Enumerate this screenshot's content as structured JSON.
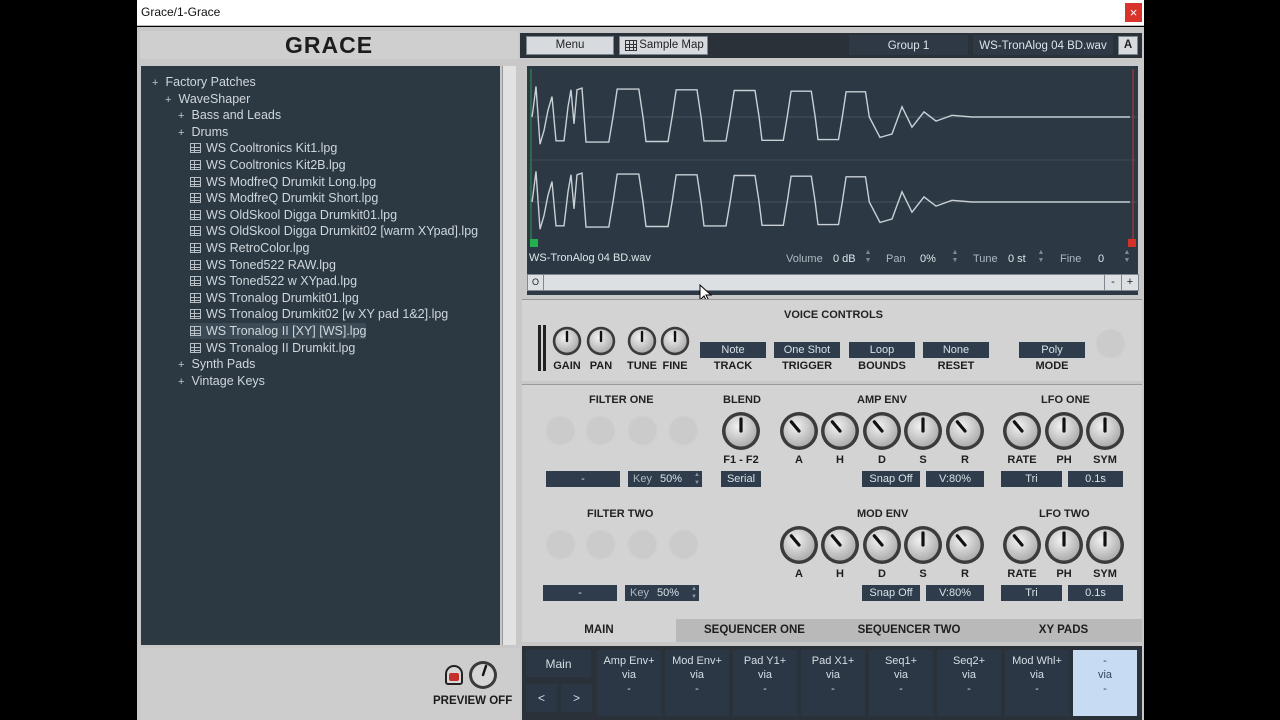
{
  "window": {
    "title": "Grace/1-Grace",
    "close": "×"
  },
  "app": {
    "logo": "GRACE"
  },
  "browser": {
    "items": [
      {
        "level": 0,
        "expander": "+",
        "label": "Factory Patches",
        "type": "folder"
      },
      {
        "level": 1,
        "expander": "+",
        "label": "WaveShaper",
        "type": "folder"
      },
      {
        "level": 2,
        "expander": "+",
        "label": "Bass and Leads",
        "type": "folder"
      },
      {
        "level": 2,
        "expander": "+",
        "label": "Drums",
        "type": "folder"
      },
      {
        "level": 3,
        "label": "WS Cooltronics Kit1.lpg",
        "type": "file"
      },
      {
        "level": 3,
        "label": "WS Cooltronics Kit2B.lpg",
        "type": "file"
      },
      {
        "level": 3,
        "label": "WS ModfreQ Drumkit Long.lpg",
        "type": "file"
      },
      {
        "level": 3,
        "label": "WS ModfreQ Drumkit Short.lpg",
        "type": "file"
      },
      {
        "level": 3,
        "label": "WS OldSkool Digga Drumkit01.lpg",
        "type": "file"
      },
      {
        "level": 3,
        "label": "WS OldSkool Digga Drumkit02 [warm XYpad].lpg",
        "type": "file"
      },
      {
        "level": 3,
        "label": "WS RetroColor.lpg",
        "type": "file"
      },
      {
        "level": 3,
        "label": "WS Toned522 RAW.lpg",
        "type": "file"
      },
      {
        "level": 3,
        "label": "WS Toned522 w XYpad.lpg",
        "type": "file"
      },
      {
        "level": 3,
        "label": "WS Tronalog Drumkit01.lpg",
        "type": "file"
      },
      {
        "level": 3,
        "label": "WS Tronalog Drumkit02 [w XY pad 1&2].lpg",
        "type": "file"
      },
      {
        "level": 3,
        "label": "WS Tronalog II  [XY] [WS].lpg",
        "type": "file",
        "selected": true
      },
      {
        "level": 3,
        "label": "WS Tronalog II Drumkit.lpg",
        "type": "file"
      },
      {
        "level": 2,
        "expander": "+",
        "label": "Synth Pads",
        "type": "folder"
      },
      {
        "level": 2,
        "expander": "+",
        "label": "Vintage Keys",
        "type": "folder"
      }
    ],
    "preview_label": "PREVIEW OFF"
  },
  "topbar": {
    "menu": "Menu",
    "sample_map": "Sample Map",
    "group": "Group 1",
    "sample": "WS-TronAlog 04 BD.wav",
    "a_button": "A"
  },
  "waveform": {
    "filename": "WS-TronAlog 04 BD.wav",
    "volume_label": "Volume",
    "volume_value": "0 dB",
    "pan_label": "Pan",
    "pan_value": "0%",
    "tune_label": "Tune",
    "tune_value": "0 st",
    "fine_label": "Fine",
    "fine_value": "0",
    "scroll_left": "O",
    "zoom_out": "-",
    "zoom_in": "+"
  },
  "voice": {
    "title": "VOICE CONTROLS",
    "knobs": [
      "GAIN",
      "PAN",
      "TUNE",
      "FINE"
    ],
    "track_value": "Note",
    "track_label": "TRACK",
    "trigger_value": "One Shot",
    "trigger_label": "TRIGGER",
    "bounds_value": "Loop",
    "bounds_label": "BOUNDS",
    "reset_value": "None",
    "reset_label": "RESET",
    "mode_value": "Poly",
    "mode_label": "MODE"
  },
  "filter_one": {
    "title": "FILTER ONE",
    "type": "-",
    "key_label": "Key",
    "key_value": "50%"
  },
  "filter_two": {
    "title": "FILTER TWO",
    "type": "-",
    "key_label": "Key",
    "key_value": "50%"
  },
  "blend": {
    "title": "BLEND",
    "knob_label": "F1 - F2",
    "mode": "Serial"
  },
  "amp_env": {
    "title": "AMP ENV",
    "knobs": [
      "A",
      "H",
      "D",
      "S",
      "R"
    ],
    "snap": "Snap Off",
    "velocity": "V:80%"
  },
  "mod_env": {
    "title": "MOD ENV",
    "knobs": [
      "A",
      "H",
      "D",
      "S",
      "R"
    ],
    "snap": "Snap Off",
    "velocity": "V:80%"
  },
  "lfo_one": {
    "title": "LFO ONE",
    "knobs": [
      "RATE",
      "PH",
      "SYM"
    ],
    "shape": "Tri",
    "time": "0.1s"
  },
  "lfo_two": {
    "title": "LFO TWO",
    "knobs": [
      "RATE",
      "PH",
      "SYM"
    ],
    "shape": "Tri",
    "time": "0.1s"
  },
  "tabs": [
    "MAIN",
    "SEQUENCER ONE",
    "SEQUENCER TWO",
    "XY PADS"
  ],
  "mod_matrix": {
    "main": "Main",
    "prev": "<",
    "next": ">",
    "slots": [
      {
        "source": "Amp Env+",
        "via": "via",
        "dest": "-"
      },
      {
        "source": "Mod Env+",
        "via": "via",
        "dest": "-"
      },
      {
        "source": "Pad Y1+",
        "via": "via",
        "dest": "-"
      },
      {
        "source": "Pad X1+",
        "via": "via",
        "dest": "-"
      },
      {
        "source": "Seq1+",
        "via": "via",
        "dest": "-"
      },
      {
        "source": "Seq2+",
        "via": "via",
        "dest": "-"
      },
      {
        "source": "Mod Whl+",
        "via": "via",
        "dest": "-"
      },
      {
        "source": "-",
        "via": "via",
        "dest": "-"
      }
    ]
  },
  "colors": {
    "accent_dark": "#2e3c4b",
    "panel": "#d3d3d3",
    "browser": "#2d3942",
    "wave": "#c9d0d6",
    "start_marker": "#23b14d",
    "end_marker": "#d4302a"
  }
}
